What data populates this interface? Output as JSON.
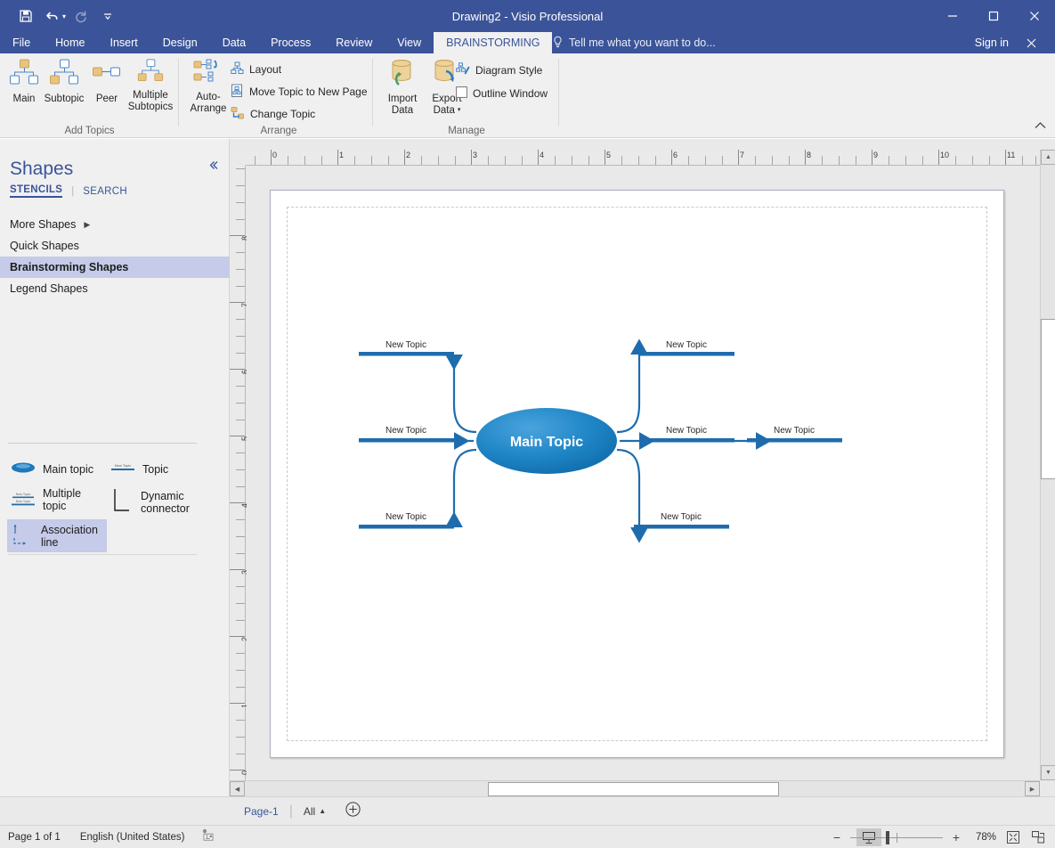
{
  "window": {
    "title": "Drawing2 - Visio Professional",
    "minimize": "minimize-icon",
    "maximize": "maximize-icon",
    "close": "close-icon",
    "sign_in": "Sign in",
    "quick_access": [
      "save-icon",
      "undo-icon",
      "redo-icon",
      "customize-qat-icon"
    ]
  },
  "ribbon": {
    "tabs": [
      {
        "label": "File",
        "active": false
      },
      {
        "label": "Home",
        "active": false
      },
      {
        "label": "Insert",
        "active": false
      },
      {
        "label": "Design",
        "active": false
      },
      {
        "label": "Data",
        "active": false
      },
      {
        "label": "Process",
        "active": false
      },
      {
        "label": "Review",
        "active": false
      },
      {
        "label": "View",
        "active": false
      },
      {
        "label": "BRAINSTORMING",
        "active": true
      }
    ],
    "tell_me": "Tell me what you want to do...",
    "groups": [
      {
        "title": "Add Topics",
        "buttons": [
          {
            "label": "Main",
            "icon": "main-topic-icon"
          },
          {
            "label": "Subtopic",
            "icon": "subtopic-icon"
          },
          {
            "label": "Peer",
            "icon": "peer-icon"
          },
          {
            "label": "Multiple\nSubtopics",
            "line1": "Multiple",
            "line2": "Subtopics",
            "icon": "multiple-subtopics-icon"
          }
        ]
      },
      {
        "title": "Arrange",
        "big": {
          "line1": "Auto-",
          "line2": "Arrange",
          "icon": "auto-arrange-icon"
        },
        "items": [
          {
            "label": "Layout",
            "icon": "layout-icon"
          },
          {
            "label": "Move Topic to New Page",
            "icon": "move-topic-icon"
          },
          {
            "label": "Change Topic",
            "icon": "change-topic-icon"
          }
        ]
      },
      {
        "title": "Manage",
        "big": [
          {
            "line1": "Import",
            "line2": "Data",
            "icon": "import-data-icon"
          },
          {
            "line1": "Export",
            "line2": "Data",
            "icon": "export-data-icon",
            "dropdown": true
          }
        ],
        "items": [
          {
            "label": "Diagram Style",
            "icon": "diagram-style-icon"
          },
          {
            "label": "Outline Window",
            "icon": "checkbox-unchecked",
            "checkbox": true
          }
        ]
      }
    ]
  },
  "shapes_pane": {
    "title": "Shapes",
    "collapse_icon": "chevron-left-icon",
    "subtabs": [
      {
        "label": "STENCILS",
        "active": true
      },
      {
        "label": "SEARCH",
        "active": false
      }
    ],
    "stencils": [
      {
        "label": "More Shapes",
        "has_arrow": true,
        "selected": false
      },
      {
        "label": "Quick Shapes",
        "has_arrow": false,
        "selected": false
      },
      {
        "label": "Brainstorming Shapes",
        "has_arrow": false,
        "selected": true
      },
      {
        "label": "Legend Shapes",
        "has_arrow": false,
        "selected": false
      }
    ],
    "shapes": [
      {
        "label": "Main topic",
        "icon": "ellipse-shape-icon",
        "selected": false
      },
      {
        "label": "Topic",
        "icon": "topic-line-icon",
        "selected": false
      },
      {
        "label": "Multiple topic",
        "line1": "Multiple",
        "line2": "topic",
        "icon": "multiple-topic-icon",
        "selected": false
      },
      {
        "label": "Dynamic connector",
        "line1": "Dynamic",
        "line2": "connector",
        "icon": "dynamic-connector-icon",
        "selected": false
      },
      {
        "label": "Association line",
        "line1": "Association",
        "line2": "line",
        "icon": "association-line-icon",
        "selected": true
      }
    ]
  },
  "canvas": {
    "ruler_h_labels": [
      "0",
      "1",
      "2",
      "3",
      "4",
      "5",
      "6",
      "7",
      "8",
      "9",
      "10",
      "11"
    ],
    "ruler_v_labels": [
      "8",
      "7",
      "6",
      "5",
      "4",
      "3",
      "2",
      "1",
      "0"
    ],
    "diagram": {
      "center": {
        "label": "Main Topic",
        "fill": "#1f7fc0"
      },
      "left_topics": [
        {
          "label": "New Topic"
        },
        {
          "label": "New Topic"
        },
        {
          "label": "New Topic"
        }
      ],
      "right_topics": [
        {
          "label": "New Topic"
        },
        {
          "label": "New Topic"
        },
        {
          "label": "New Topic"
        }
      ],
      "right_child": {
        "label": "New Topic"
      },
      "line_color": "#1f6cad"
    }
  },
  "page_tabs": {
    "current": "Page-1",
    "all_label": "All",
    "add_icon": "add-page-icon"
  },
  "status_bar": {
    "page_count": "Page 1 of 1",
    "language": "English (United States)",
    "macro_icon": "macro-record-icon",
    "presentation_icon": "presentation-mode-icon",
    "zoom_out": "−",
    "zoom_in": "+",
    "zoom_level": "78%",
    "fit_page_icon": "fit-page-icon",
    "fit_window_icon": "fit-window-icon"
  }
}
